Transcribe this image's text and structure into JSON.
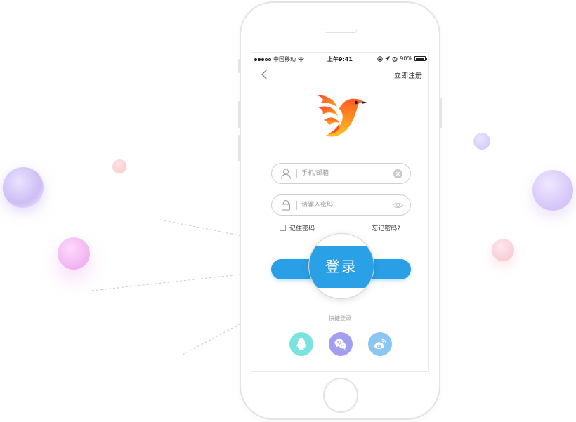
{
  "status_bar": {
    "carrier": "中国移动",
    "time": "上午9:41",
    "battery": "90%"
  },
  "nav": {
    "register_link": "立即注册"
  },
  "form": {
    "account_placeholder": "手机/邮箱",
    "password_placeholder": "请输入密码",
    "remember_label": "记住密码",
    "forgot_link": "忘记密码?"
  },
  "login_button": {
    "label": "登录"
  },
  "quick_login": {
    "title": "快捷登录",
    "options": [
      "qq-icon",
      "wechat-icon",
      "weibo-icon"
    ]
  },
  "colors": {
    "primary": "#2a9fe6",
    "qq": "#7be3df",
    "wechat": "#a39ef0",
    "weibo": "#8bc5f2"
  }
}
